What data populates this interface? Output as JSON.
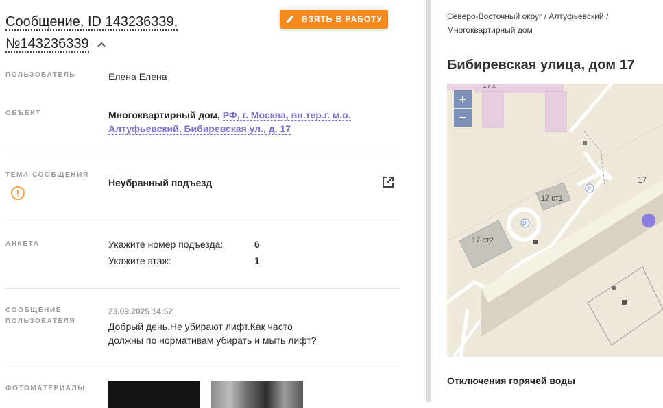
{
  "header": {
    "title_line1": "Сообщение, ID 143236339,",
    "title_line2": "№143236339",
    "take_button": "ВЗЯТЬ В РАБОТУ"
  },
  "fields": {
    "user_label": "ПОЛЬЗОВАТЕЛЬ",
    "user_value": "Елена Елена",
    "object_label": "ОБЪЕКТ",
    "object_type": "Многоквартирный дом,",
    "object_addr_line1": "РФ, г. Москва, вн.тер.г. м.о.",
    "object_addr_line2": "Алтуфьевский, Бибиревская ул., д. 17",
    "topic_label": "ТЕМА СООБЩЕНИЯ",
    "topic_value": "Неубранный подъезд",
    "anketa_label": "АНКЕТА",
    "anketa": [
      {
        "question": "Укажите номер подъезда:",
        "answer": "6"
      },
      {
        "question": "Укажите этаж:",
        "answer": "1"
      }
    ],
    "message_label_line1": "СООБЩЕНИЕ",
    "message_label_line2": "ПОЛЬЗОВАТЕЛЯ",
    "message_date": "23.09.2025 14:52",
    "message_line1": "Добрый день.Не убирают лифт.Как часто",
    "message_line2": "должны по нормативам убирать и мыть лифт?",
    "photos_label": "ФОТОМАТЕРИАЛЫ"
  },
  "right": {
    "breadcrumb_line1": "Северо-Восточный округ / Алтуфьевский /",
    "breadcrumb_line2": "Многоквартирный дом",
    "address_title": "Бибиревская улица, дом 17",
    "section_title": "Отключения горячей воды",
    "map": {
      "zoom_in": "+",
      "zoom_out": "−",
      "labels": {
        "b17a": "17а",
        "b17": "17",
        "b17st1": "17 ст1",
        "b17st2": "17 ст2",
        "parking": "P"
      }
    }
  },
  "colors": {
    "accent_orange": "#f58a1f",
    "link_purple": "#7b6fd0",
    "zoom_blue": "#7c8fb7",
    "marker": "#8a7ee0"
  }
}
